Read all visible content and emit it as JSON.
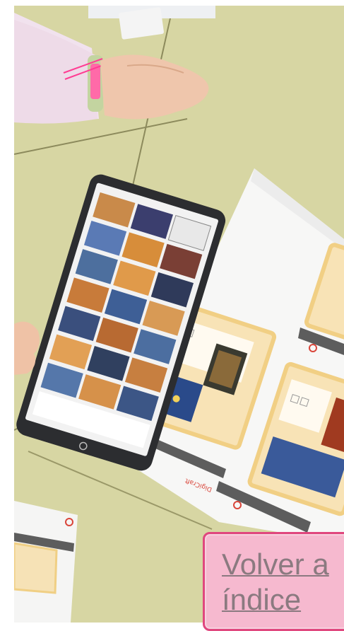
{
  "photo": {
    "alt_subject": "tablet-on-desk-with-art-cards",
    "tablet_brand_mark": "circle-logo",
    "sheet_brand": "DigiCraft",
    "accent_colors": {
      "desk": "#d6d5a0",
      "sheet_frame": "#f3d79a",
      "brand_red": "#d9453a",
      "pink_button": "#f6b9cf",
      "pink_border": "#e0477e"
    }
  },
  "nav": {
    "back_line1": "Volver a",
    "back_line2": "índice"
  }
}
